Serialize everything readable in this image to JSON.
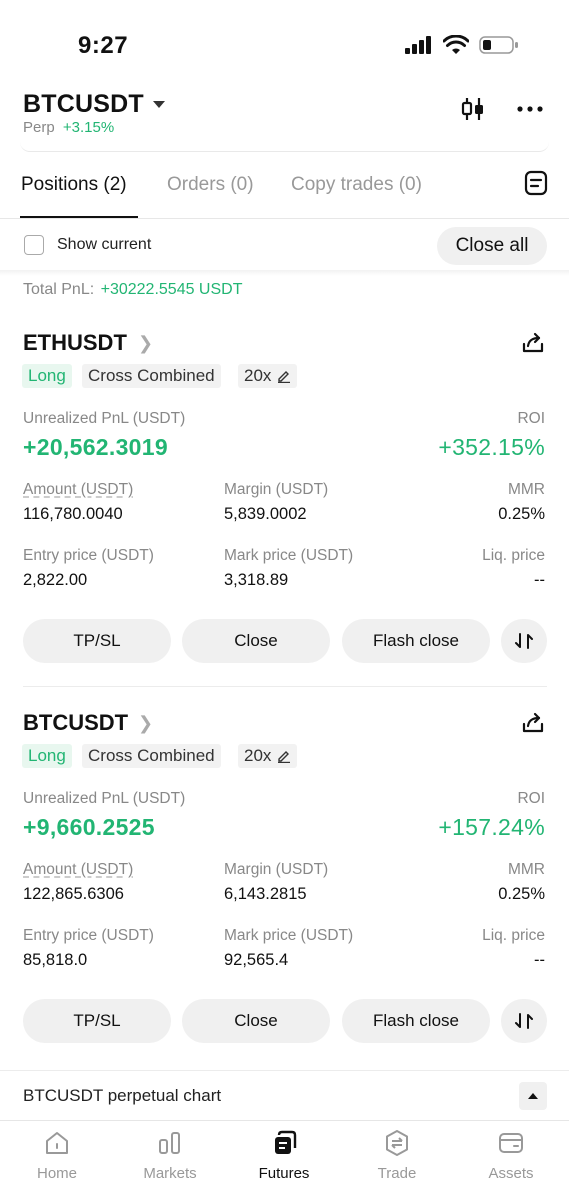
{
  "status": {
    "time": "9:27"
  },
  "header": {
    "symbol": "BTCUSDT",
    "type": "Perp",
    "change": "+3.15%"
  },
  "tabs": [
    {
      "label": "Positions (2)",
      "active": true
    },
    {
      "label": "Orders (0)",
      "active": false
    },
    {
      "label": "Copy trades (0)",
      "active": false
    }
  ],
  "filter": {
    "show_current_label": "Show current",
    "close_all_label": "Close all"
  },
  "summary": {
    "total_pnl_label": "Total PnL:",
    "total_pnl_value": "+30222.5545 USDT"
  },
  "positions": [
    {
      "pair": "ETHUSDT",
      "side": "Long",
      "margin_mode": "Cross Combined",
      "leverage": "20x",
      "unrealized_label": "Unrealized PnL (USDT)",
      "unrealized_value": "+20,562.3019",
      "roi_label": "ROI",
      "roi_value": "+352.15%",
      "amount_label": "Amount (USDT)",
      "amount_value": "116,780.0040",
      "margin_label": "Margin (USDT)",
      "margin_value": "5,839.0002",
      "mmr_label": "MMR",
      "mmr_value": "0.25%",
      "entry_label": "Entry price (USDT)",
      "entry_value": "2,822.00",
      "mark_label": "Mark price (USDT)",
      "mark_value": "3,318.89",
      "liq_label": "Liq. price",
      "liq_value": "--"
    },
    {
      "pair": "BTCUSDT",
      "side": "Long",
      "margin_mode": "Cross Combined",
      "leverage": "20x",
      "unrealized_label": "Unrealized PnL (USDT)",
      "unrealized_value": "+9,660.2525",
      "roi_label": "ROI",
      "roi_value": "+157.24%",
      "amount_label": "Amount (USDT)",
      "amount_value": "122,865.6306",
      "margin_label": "Margin (USDT)",
      "margin_value": "6,143.2815",
      "mmr_label": "MMR",
      "mmr_value": "0.25%",
      "entry_label": "Entry price (USDT)",
      "entry_value": "85,818.0",
      "mark_label": "Mark price (USDT)",
      "mark_value": "92,565.4",
      "liq_label": "Liq. price",
      "liq_value": "--"
    }
  ],
  "actions": {
    "tpsl": "TP/SL",
    "close": "Close",
    "flash_close": "Flash close"
  },
  "chart_bar": {
    "label": "BTCUSDT perpetual chart"
  },
  "nav": [
    {
      "label": "Home",
      "icon": "home-icon"
    },
    {
      "label": "Markets",
      "icon": "markets-icon"
    },
    {
      "label": "Futures",
      "icon": "futures-icon",
      "active": true
    },
    {
      "label": "Trade",
      "icon": "trade-icon"
    },
    {
      "label": "Assets",
      "icon": "assets-icon"
    }
  ],
  "colors": {
    "positive": "#22b573",
    "muted": "#888888"
  }
}
